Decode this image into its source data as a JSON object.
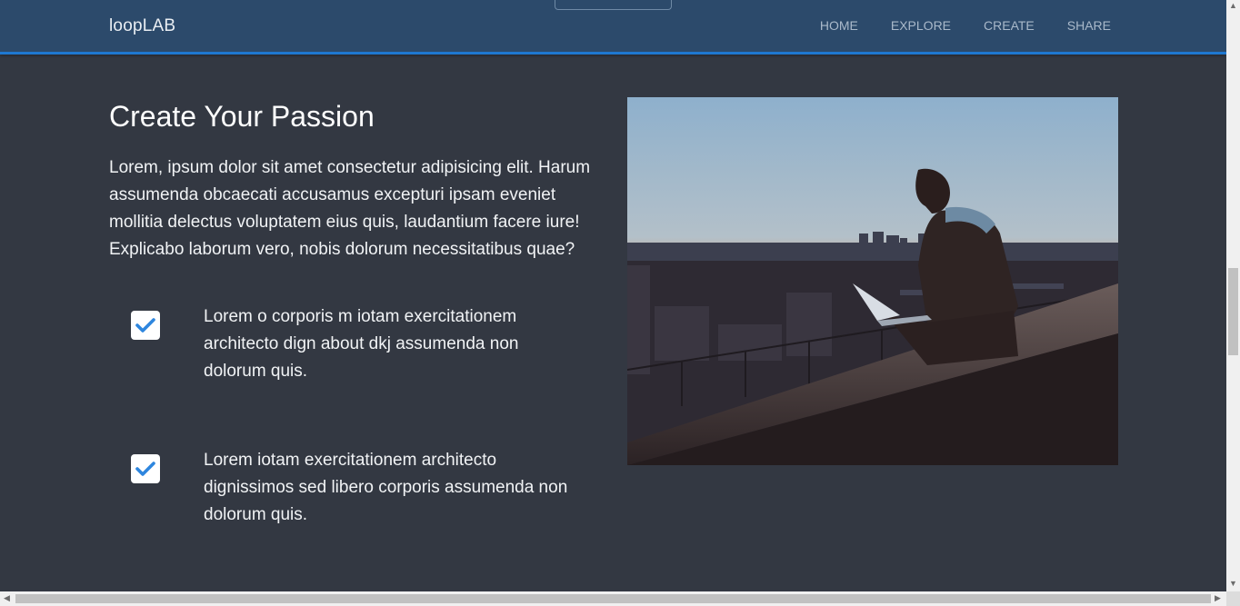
{
  "nav": {
    "brand": "loopLAB",
    "links": [
      "HOME",
      "EXPLORE",
      "CREATE",
      "SHARE"
    ]
  },
  "section": {
    "title": "Create Your Passion",
    "intro": "Lorem, ipsum dolor sit amet consectetur adipisicing elit. Harum assumenda obcaecati accusamus excepturi ipsam eveniet mollitia delectus voluptatem eius quis, laudantium facere iure! Explicabo laborum vero, nobis dolorum necessitatibus quae?",
    "features": [
      {
        "icon": "check-icon",
        "text": "Lorem o corporis m iotam exercitationem architecto dign about dkj assumenda non dolorum quis."
      },
      {
        "icon": "check-icon",
        "text": "Lorem iotam exercitationem architecto dignissimos sed libero corporis assumenda non dolorum quis."
      }
    ]
  },
  "colors": {
    "navbar": "#2c4a6b",
    "accent": "#1f78d1",
    "background": "#333842",
    "check": "#2e86de"
  }
}
